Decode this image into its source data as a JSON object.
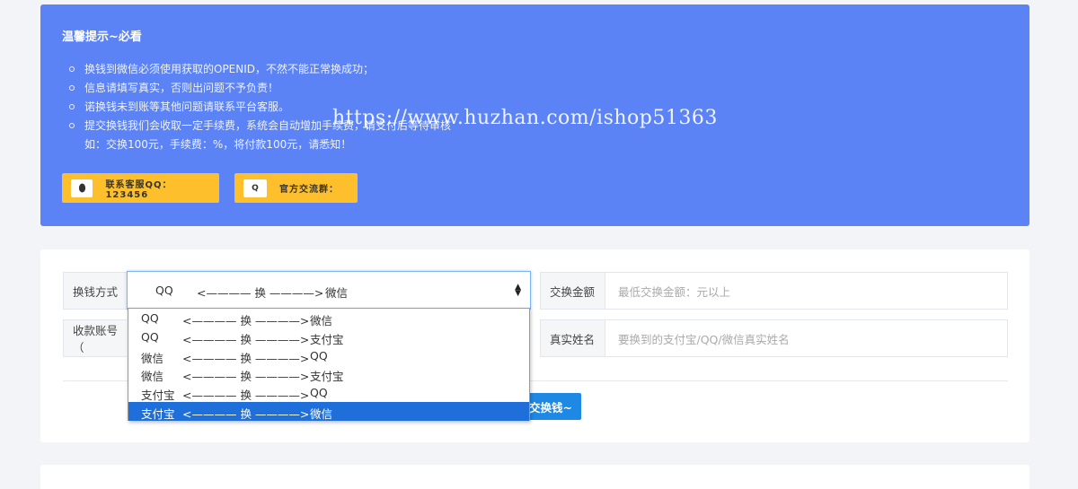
{
  "notice": {
    "title": "温馨提示~必看",
    "items": [
      "换钱到微信必须使用获取的OPENID，不然不能正常换成功；",
      "信息请填写真实，否则出问题不予负责！",
      "诺换钱未到账等其他问题请联系平台客服。",
      "提交换钱我们会收取一定手续费，系统会自动增加手续费，请支付后等待审核",
      "如：交换100元，手续费：%，将付款100元，请悉知！"
    ],
    "contact_qq_label": "联系客服QQ：123456",
    "contact_group_label": "官方交流群：",
    "qq_icon": "penguin-icon",
    "group_icon_text": "Q"
  },
  "watermark": "https://www.huzhan.com/ishop51363",
  "form": {
    "method_label": "换钱方式",
    "method_selected": {
      "from": "QQ",
      "mid": "<———— 换 ————>",
      "to": "微信"
    },
    "amount_label": "交换金额",
    "amount_placeholder": "最低交换金额：元以上",
    "account_label": "收款账号（",
    "name_label": "真实姓名",
    "name_placeholder": "要换到的支付宝/QQ/微信真实姓名",
    "submit_label": "交换钱~"
  },
  "dropdown_options": [
    {
      "from": "QQ",
      "mid": "<———— 换 ————>",
      "to": "微信"
    },
    {
      "from": "QQ",
      "mid": "<———— 换 ————>",
      "to": "支付宝"
    },
    {
      "from": "微信",
      "mid": "<———— 换 ————>",
      "to": "QQ"
    },
    {
      "from": "微信",
      "mid": "<———— 换 ————>",
      "to": "支付宝"
    },
    {
      "from": "支付宝",
      "mid": "<———— 换 ————>",
      "to": "QQ"
    },
    {
      "from": "支付宝",
      "mid": "<———— 换 ————>",
      "to": "微信"
    }
  ],
  "dropdown_selected_index": 5,
  "colors": {
    "notice_bg": "#5b83f5",
    "button_yellow": "#fdc02c",
    "primary_blue": "#1e88e5",
    "highlight": "#1e6fd9"
  }
}
